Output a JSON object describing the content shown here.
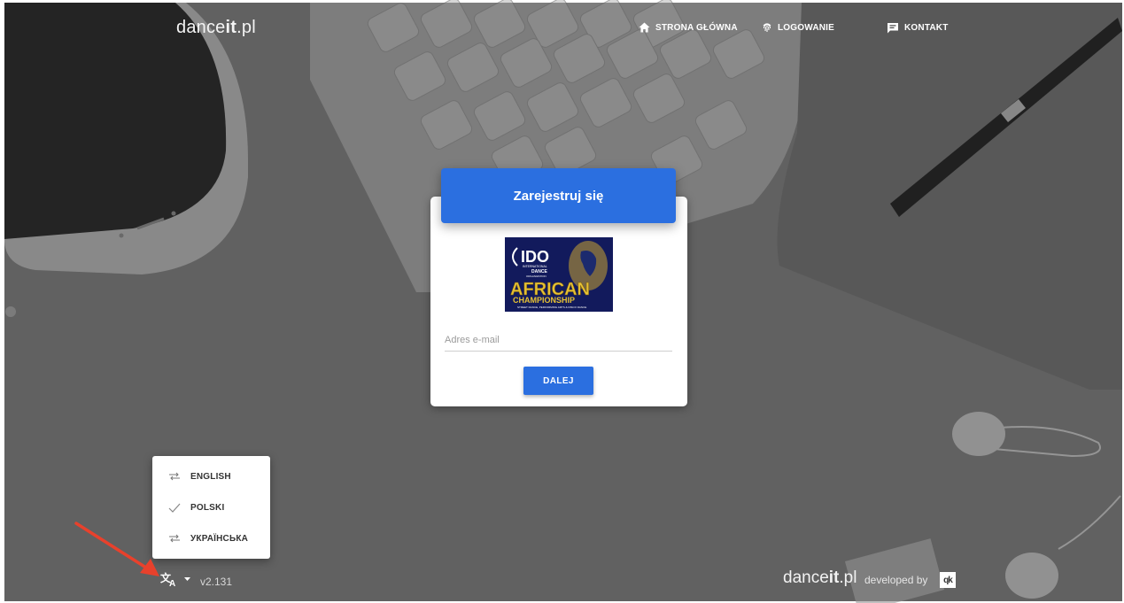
{
  "header": {
    "brand_prefix": "dance",
    "brand_bold": "it",
    "brand_suffix": ".pl",
    "nav": [
      {
        "label": "STRONA GŁÓWNA",
        "icon": "home-icon"
      },
      {
        "label": "LOGOWANIE",
        "icon": "fingerprint-icon"
      },
      {
        "label": "KONTAKT",
        "icon": "message-icon"
      }
    ]
  },
  "register": {
    "title": "Zarejestruj się",
    "logo": {
      "line1": "IDO",
      "line2": "INTERNATIONAL",
      "line3": "DANCE",
      "line4": "ORGANIZATION",
      "headline": "AFRICAN",
      "subline": "CHAMPIONSHIP",
      "tagline": "STREET DANCE, PERFORMING ARTS & DISCO DANCE"
    },
    "email_placeholder": "Adres e-mail",
    "next_label": "DALEJ"
  },
  "language_menu": {
    "items": [
      {
        "label": "ENGLISH",
        "icon": "swap-icon",
        "selected": false
      },
      {
        "label": "POLSKI",
        "icon": "check-icon",
        "selected": true
      },
      {
        "label": "УКРАЇНСЬКА",
        "icon": "swap-icon",
        "selected": false
      }
    ]
  },
  "footer": {
    "version": "v2.131",
    "brand_prefix": "dance",
    "brand_bold": "it",
    "brand_suffix": ".pl",
    "developed_by": "developed by",
    "dev_logo": "qk"
  },
  "colors": {
    "accent": "#2b6fe0",
    "arrow": "#e8412c"
  }
}
